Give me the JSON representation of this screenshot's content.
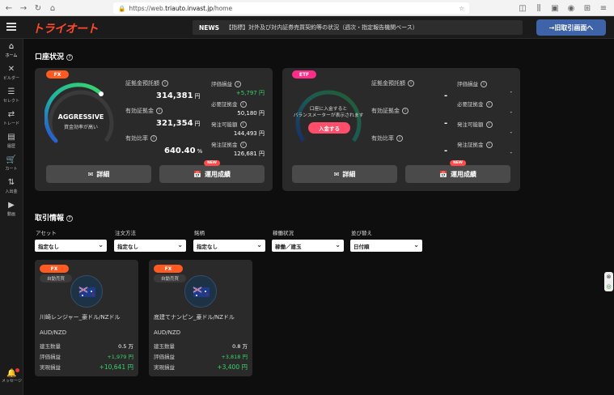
{
  "browser": {
    "url_prefix": "https://web.",
    "url_domain": "triauto.invast.jp",
    "url_suffix": "/home"
  },
  "header": {
    "logo": "トライオート",
    "news_tag": "NEWS",
    "news_text": "【指標】対外及び対内証券売買契約等の状況（週次・指定報告機関ベース）",
    "old_screen_button": "→旧取引画面へ"
  },
  "sidebar": {
    "items": [
      {
        "icon": "home-icon",
        "label": "ホーム"
      },
      {
        "icon": "builder-icon",
        "label": "ビルダー"
      },
      {
        "icon": "select-icon",
        "label": "セレクト"
      },
      {
        "icon": "trade-icon",
        "label": "トレード"
      },
      {
        "icon": "history-icon",
        "label": "履歴"
      },
      {
        "icon": "cart-icon",
        "label": "カート"
      },
      {
        "icon": "deposit-icon",
        "label": "入出金"
      },
      {
        "icon": "video-icon",
        "label": "動画"
      }
    ],
    "message_label": "メッセージ"
  },
  "account": {
    "title": "口座状況",
    "fx": {
      "badge": "FX",
      "gauge_label": "AGGRESSIVE",
      "gauge_sub": "資金効率が高い",
      "deposit_label": "証拠金預託額",
      "deposit_value": "314,381",
      "effective_label": "有効証拠金",
      "effective_value": "321,354",
      "ratio_label": "有効比率",
      "ratio_value": "640.40",
      "pnl_label": "評価損益",
      "pnl_value": "+5,797",
      "required_label": "必要証拠金",
      "required_value": "50,180",
      "available_label": "発注可能額",
      "available_value": "144,493",
      "order_margin_label": "発注証拠金",
      "order_margin_value": "126,681",
      "yen": "円",
      "percent": "%",
      "detail_button": "詳細",
      "results_button": "運用成績",
      "new_badge": "NEW"
    },
    "etf": {
      "badge": "ETF",
      "gauge_msg1": "口座に入金すると",
      "gauge_msg2": "バランスメーターが表示されます",
      "deposit_button": "入金する",
      "deposit_label": "証拠金預託額",
      "effective_label": "有効証拠金",
      "ratio_label": "有効比率",
      "pnl_label": "評価損益",
      "required_label": "必要証拠金",
      "available_label": "発注可能額",
      "order_margin_label": "発注証拠金",
      "dash": "-",
      "detail_button": "詳細",
      "results_button": "運用成績",
      "new_badge": "NEW"
    }
  },
  "trading": {
    "title": "取引情報",
    "filters": [
      {
        "label": "アセット",
        "value": "指定なし"
      },
      {
        "label": "注文方法",
        "value": "指定なし"
      },
      {
        "label": "銘柄",
        "value": "指定なし"
      },
      {
        "label": "稼働状況",
        "value": "稼働／建玉"
      },
      {
        "label": "並び替え",
        "value": "日付順"
      }
    ],
    "cards": [
      {
        "badge": "FX",
        "mode": "自動売買",
        "name": "川崎レンジャー_豪ドル/NZドル",
        "pair": "AUD/NZD",
        "position_label": "建玉数量",
        "position_value": "0.5",
        "position_unit": "万",
        "pnl_label": "評価損益",
        "pnl_value": "+1,979",
        "realized_label": "実現損益",
        "realized_value": "+10,641",
        "yen": "円"
      },
      {
        "badge": "FX",
        "mode": "自動売買",
        "name": "底建てナンピン_豪ドル/NZドル",
        "pair": "AUD/NZD",
        "position_label": "建玉数量",
        "position_value": "0.8",
        "position_unit": "万",
        "pnl_label": "評価損益",
        "pnl_value": "+3,818",
        "realized_label": "実現損益",
        "realized_value": "+3,400",
        "yen": "円"
      }
    ]
  },
  "colors": {
    "accent": "#ff4a2a",
    "fx_badge": "#ff5a22",
    "etf_badge": "#ff2d8a",
    "positive": "#39d46a",
    "old_button": "#3f63a8"
  }
}
